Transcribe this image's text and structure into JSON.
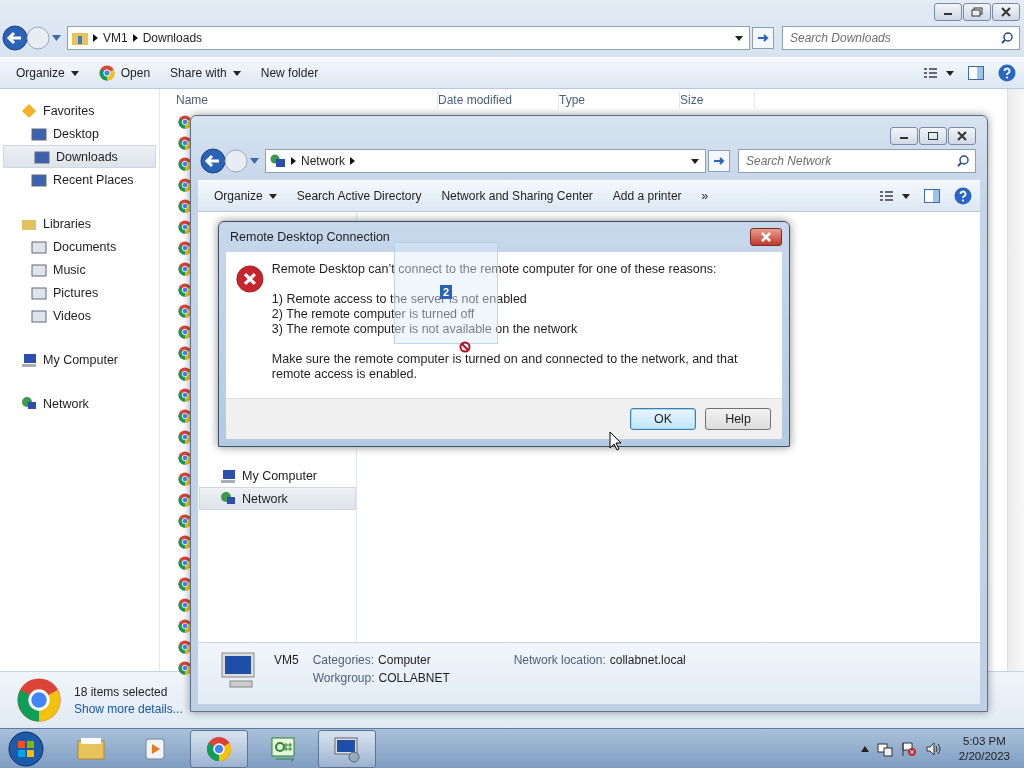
{
  "explorer": {
    "address": [
      "VM1",
      "Downloads"
    ],
    "search": {
      "placeholder": "Search Downloads"
    },
    "toolbar": [
      {
        "label": "Organize",
        "kind": "menu"
      },
      {
        "label": "Open",
        "kind": "app"
      },
      {
        "label": "Share with",
        "kind": "menu"
      },
      {
        "label": "New folder",
        "kind": "plain"
      }
    ],
    "columns": [
      "Name",
      "Date modified",
      "Type",
      "Size"
    ],
    "sidebar": [
      {
        "label": "Favorites",
        "selected": false,
        "children": [
          {
            "label": "Desktop",
            "selected": false
          },
          {
            "label": "Downloads",
            "selected": true
          },
          {
            "label": "Recent Places",
            "selected": false
          }
        ]
      },
      {
        "label": "Libraries",
        "selected": false,
        "children": [
          {
            "label": "Documents",
            "selected": false
          },
          {
            "label": "Music",
            "selected": false
          },
          {
            "label": "Pictures",
            "selected": false
          },
          {
            "label": "Videos",
            "selected": false
          }
        ]
      },
      {
        "label": "My Computer",
        "selected": false
      },
      {
        "label": "Network",
        "selected": false
      }
    ],
    "status": {
      "selection": "18 items selected",
      "link": "Show more details..."
    }
  },
  "network_window": {
    "address": [
      "Network"
    ],
    "search": {
      "placeholder": "Search Network"
    },
    "toolbar": [
      {
        "label": "Organize",
        "kind": "menu"
      },
      {
        "label": "Search Active Directory",
        "kind": "plain"
      },
      {
        "label": "Network and Sharing Center",
        "kind": "plain"
      },
      {
        "label": "Add a printer",
        "kind": "plain"
      },
      {
        "label": "»",
        "kind": "plain"
      }
    ],
    "sidebar": [
      {
        "label": "My Computer",
        "selected": false
      },
      {
        "label": "Network",
        "selected": true
      }
    ],
    "details": {
      "name": "VM5",
      "fields": [
        {
          "label": "Categories:",
          "value": "Computer"
        },
        {
          "label": "Workgroup:",
          "value": "COLLABNET"
        },
        {
          "label": "Network location:",
          "value": "collabnet.local"
        }
      ]
    }
  },
  "dialog": {
    "title": "Remote Desktop Connection",
    "message": "Remote Desktop can’t connect to the remote computer for one of these reasons:",
    "reasons": [
      "1) Remote access to the server is not enabled",
      "2) The remote computer is turned off",
      "3) The remote computer is not available on the network"
    ],
    "note": "Make sure the remote computer is turned on and connected to the network, and that remote access is enabled.",
    "buttons": [
      {
        "label": "OK",
        "default": true
      },
      {
        "label": "Help",
        "default": false
      }
    ]
  },
  "drag": {
    "count": "2"
  },
  "taskbar": {
    "apps": [
      {
        "kind": "folder",
        "active": false
      },
      {
        "kind": "media",
        "active": false
      },
      {
        "kind": "browser",
        "active": true
      },
      {
        "kind": "code",
        "active": false
      },
      {
        "kind": "remote",
        "active": true
      }
    ],
    "time": "5:03 PM",
    "date": "2/20/2023"
  }
}
